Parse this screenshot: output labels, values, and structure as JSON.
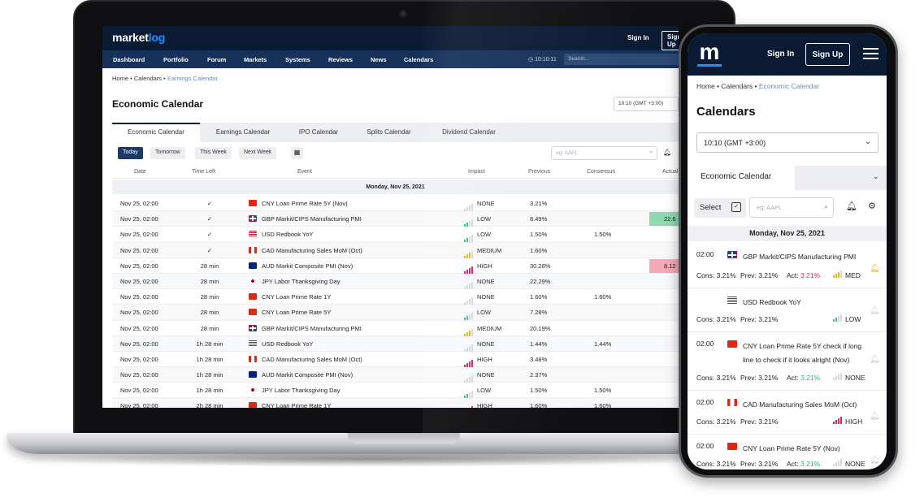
{
  "laptop": {
    "brand": {
      "part1": "market",
      "part2": "log"
    },
    "header": {
      "sign_in": "Sign In",
      "sign_up": "Sign Up"
    },
    "nav": [
      "Dashboard",
      "Portfolio",
      "Forum",
      "Markets",
      "Systems",
      "Reviews",
      "News",
      "Calendars"
    ],
    "clock": "10:10:11",
    "search_placeholder": "Search...",
    "breadcrumb": {
      "home": "Home",
      "sep": "•",
      "section": "Calendars",
      "current": "Earnings Calendar"
    },
    "page_title": "Economic Calendar",
    "timezone": "10:10 (GMT +3:00)",
    "tabs": [
      "Economic Calendar",
      "Earnings Calendar",
      "IPO Calendar",
      "Splits Calendar",
      "Dividend Calendar"
    ],
    "active_tab": 0,
    "filters": [
      "Today",
      "Tomorrow",
      "This Week",
      "Next Week"
    ],
    "filter_search_placeholder": "eg: AAPL",
    "columns": [
      "Date",
      "Time Left",
      "Event",
      "Impact",
      "Previous",
      "Consensus",
      "Actual"
    ],
    "day_header": "Monday, Nov 25, 2021",
    "rows": [
      {
        "date": "Nov 25, 02:00",
        "time_left": "✓",
        "flag": "cn",
        "event": "CNY  Loan Prime Rate 5Y (Nov)",
        "impact": "NONE",
        "level": 0,
        "previous": "3.21%",
        "consensus": "",
        "actual": ""
      },
      {
        "date": "Nov 25, 02:00",
        "time_left": "✓",
        "flag": "gb",
        "event": "GBP  Markit/CIPS Manufacturing PMI",
        "impact": "LOW",
        "level": 1,
        "previous": "8.49%",
        "consensus": "",
        "actual": "22.6",
        "actual_color": "#8fd9b0"
      },
      {
        "date": "Nov 25, 02:00",
        "time_left": "✓",
        "flag": "us",
        "event": "USD  Redbook YoY",
        "impact": "LOW",
        "level": 1,
        "previous": "1.50%",
        "consensus": "1.50%",
        "actual": ""
      },
      {
        "date": "Nov 25, 02:00",
        "time_left": "✓",
        "flag": "ca",
        "event": "CAD  Manufacturing Sales MoM (Oct)",
        "impact": "MEDIUM",
        "level": 2,
        "previous": "1.60%",
        "consensus": "",
        "actual": ""
      },
      {
        "date": "Nov 25, 02:00",
        "time_left": "28 min",
        "flag": "au",
        "event": "AUD  Markit Composite PMI (Nov)",
        "impact": "HIGH",
        "level": 3,
        "previous": "30.28%",
        "consensus": "",
        "actual": "8.12",
        "actual_color": "#f3a9b6"
      },
      {
        "date": "Nov 25, 02:00",
        "time_left": "28 min",
        "flag": "jp",
        "event": "JPY  Labor Thanksgiving Day",
        "impact": "NONE",
        "level": 0,
        "previous": "22.29%",
        "consensus": "",
        "actual": ""
      },
      {
        "date": "Nov 25, 02:00",
        "time_left": "28 min",
        "flag": "cn",
        "event": "CNY  Loan Prime Rate 1Y",
        "impact": "NONE",
        "level": 0,
        "previous": "1.60%",
        "consensus": "1.60%",
        "actual": ""
      },
      {
        "date": "Nov 25, 02:00",
        "time_left": "28 min",
        "flag": "cn",
        "event": "CNY  Loan Prime Rate 5Y",
        "impact": "LOW",
        "level": 1,
        "previous": "7.28%",
        "consensus": "",
        "actual": ""
      },
      {
        "date": "Nov 25, 02:00",
        "time_left": "28 min",
        "flag": "gb",
        "event": "GBP  Markit/CIPS Manufacturing PMI",
        "impact": "MEDIUM",
        "level": 2,
        "previous": "20.19%",
        "consensus": "",
        "actual": ""
      },
      {
        "date": "Nov 25, 02:00",
        "time_left": "1h 28 min",
        "flag": "us",
        "event": "USD  Redbook YoY",
        "impact": "NONE",
        "level": 0,
        "previous": "1.44%",
        "consensus": "1.44%",
        "actual": ""
      },
      {
        "date": "Nov 25, 02:00",
        "time_left": "1h 28 min",
        "flag": "ca",
        "event": "CAD  Manufacturing Sales MoM (Oct)",
        "impact": "HIGH",
        "level": 3,
        "previous": "3.48%",
        "consensus": "",
        "actual": ""
      },
      {
        "date": "Nov 25, 02:00",
        "time_left": "1h 28 min",
        "flag": "au",
        "event": "AUD  Markit Composite PMI (Nov)",
        "impact": "NONE",
        "level": 0,
        "previous": "2.37%",
        "consensus": "",
        "actual": ""
      },
      {
        "date": "Nov 25, 02:00",
        "time_left": "1h 28 min",
        "flag": "jp",
        "event": "JPY  Labor Thanksgiving Day",
        "impact": "LOW",
        "level": 1,
        "previous": "1.50%",
        "consensus": "1.50%",
        "actual": ""
      },
      {
        "date": "Nov 25, 02:00",
        "time_left": "2h 28 min",
        "flag": "cn",
        "event": "CNY  Loan Prime Rate 1Y",
        "impact": "HIGH",
        "level": 3,
        "previous": "1.60%",
        "consensus": "1.60%",
        "actual": ""
      }
    ]
  },
  "phone": {
    "logo": "m",
    "sign_in": "Sign In",
    "sign_up": "Sign Up",
    "breadcrumb": {
      "home": "Home",
      "sep": "•",
      "section": "Calendars",
      "current": "Economic Calendar"
    },
    "page_title": "Calendars",
    "timezone": "10:10 (GMT +3:00)",
    "calendar_tab": "Economic Calendar",
    "select_label": "Select",
    "search_placeholder": "eg: AAPL",
    "day_header": "Monday, Nov 25, 2021",
    "items": [
      {
        "time": "02:00",
        "flag": "gb",
        "event": "GBP  Markit/CIPS Manufacturing PMI",
        "cons": "Cons: 3.21%",
        "prev": "Prev: 3.21%",
        "act_label": "Act: ",
        "act": "3.21%",
        "act_color": "#e0245e",
        "impact": "MED",
        "level": 2,
        "bell_on": true
      },
      {
        "time": "",
        "flag": "us",
        "event": "USD  Redbook YoY",
        "cons": "Cons: 3.21%",
        "prev": "Prev: 3.21%",
        "act_label": "",
        "act": "",
        "act_color": "",
        "impact": "LOW",
        "level": 1,
        "bell_on": false
      },
      {
        "time": "02:00",
        "flag": "cn",
        "event": "CNY  Loan Prime Rate 5Y check if long line to check if it looks alright (Nov)",
        "cons": "Cons: 3.21%",
        "prev": "Prev: 3.21%",
        "act_label": "Act: ",
        "act": "3.21%",
        "act_color": "#2fb36d",
        "impact": "NONE",
        "level": 0,
        "bell_on": false
      },
      {
        "time": "02:00",
        "flag": "ca",
        "event": "CAD  Manufacturing Sales MoM (Oct)",
        "cons": "Cons: 3.21%",
        "prev": "Prev: 3.21%",
        "act_label": "",
        "act": "",
        "act_color": "",
        "impact": "HIGH",
        "level": 3,
        "bell_on": false
      },
      {
        "time": "02:00",
        "flag": "cn",
        "event": "CNY  Loan Prime Rate 5Y (Nov)",
        "cons": "Cons: 3.21%",
        "prev": "Prev: 3.21%",
        "act_label": "Act: ",
        "act": "3.21%",
        "act_color": "#2fb36d",
        "impact": "NONE",
        "level": 0,
        "bell_on": false
      }
    ]
  },
  "colors": {
    "navy": "#0b1b34",
    "nav_blue": "#16315a",
    "accent": "#1e90ff",
    "impact_low": "#3cc47c",
    "impact_medium": "#f5b400",
    "impact_high": "#e0245e",
    "bell_on": "#f5b400"
  }
}
